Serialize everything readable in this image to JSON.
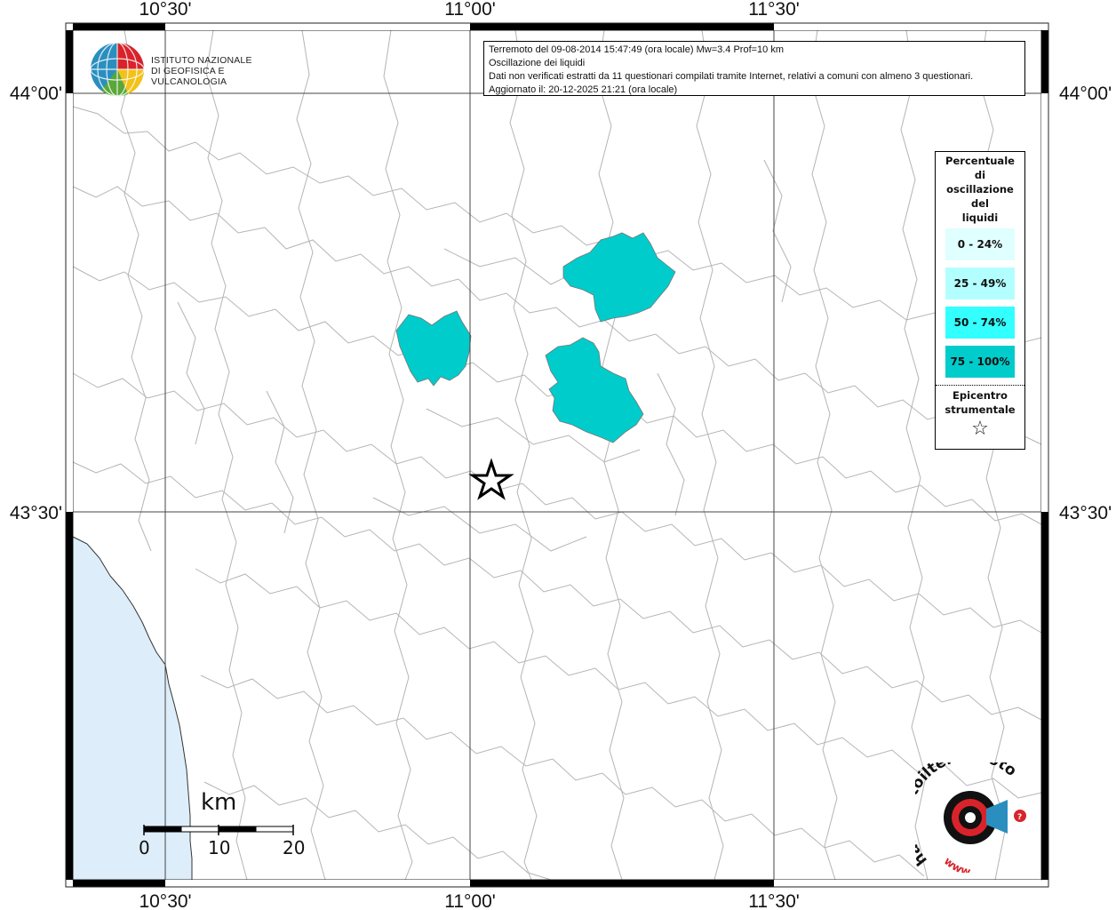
{
  "header": {
    "line1": "Terremoto del 09-08-2014 15:47:49 (ora locale) Mw=3.4 Prof=10 km",
    "line2": "Oscillazione dei liquidi",
    "line3": "Dati non verificati estratti da 11 questionari compilati tramite Internet, relativi a comuni con almeno 3 questionari.",
    "line4": "Aggiornato il: 20-12-2025 21:21 (ora locale)"
  },
  "institute": {
    "line1": "ISTITUTO NAZIONALE",
    "line2": "DI GEOFISICA E VULCANOLOGIA"
  },
  "axes": {
    "lon_labels": [
      "10°30'",
      "11°00'",
      "11°30'"
    ],
    "lat_labels": [
      "44°00'",
      "43°30'"
    ]
  },
  "legend": {
    "title": [
      "Percentuale",
      "di",
      "oscillazione",
      "del",
      "liquidi"
    ],
    "classes": [
      {
        "label": "0 - 24%",
        "color": "#e0ffff"
      },
      {
        "label": "25 - 49%",
        "color": "#b3ffff"
      },
      {
        "label": "50 - 74%",
        "color": "#33ffff"
      },
      {
        "label": "75 - 100%",
        "color": "#00cccc"
      }
    ],
    "epicenter_line1": "Epicentro",
    "epicenter_line2": "strumentale",
    "epicenter_symbol": "☆"
  },
  "scale": {
    "unit": "km",
    "ticks": [
      "0",
      "10",
      "20"
    ]
  },
  "branding": {
    "haisentito": "haisentitoilterremoto.it",
    "www": "www."
  },
  "colors": {
    "sea": "#ddeefa",
    "affected": "#00cccc",
    "border": "#b4b4b4",
    "grid": "#444444"
  },
  "map_layers": {
    "affected_municipalities": 3,
    "affected_class": "75 - 100%",
    "epicenter_icon": "star-outline-icon"
  }
}
